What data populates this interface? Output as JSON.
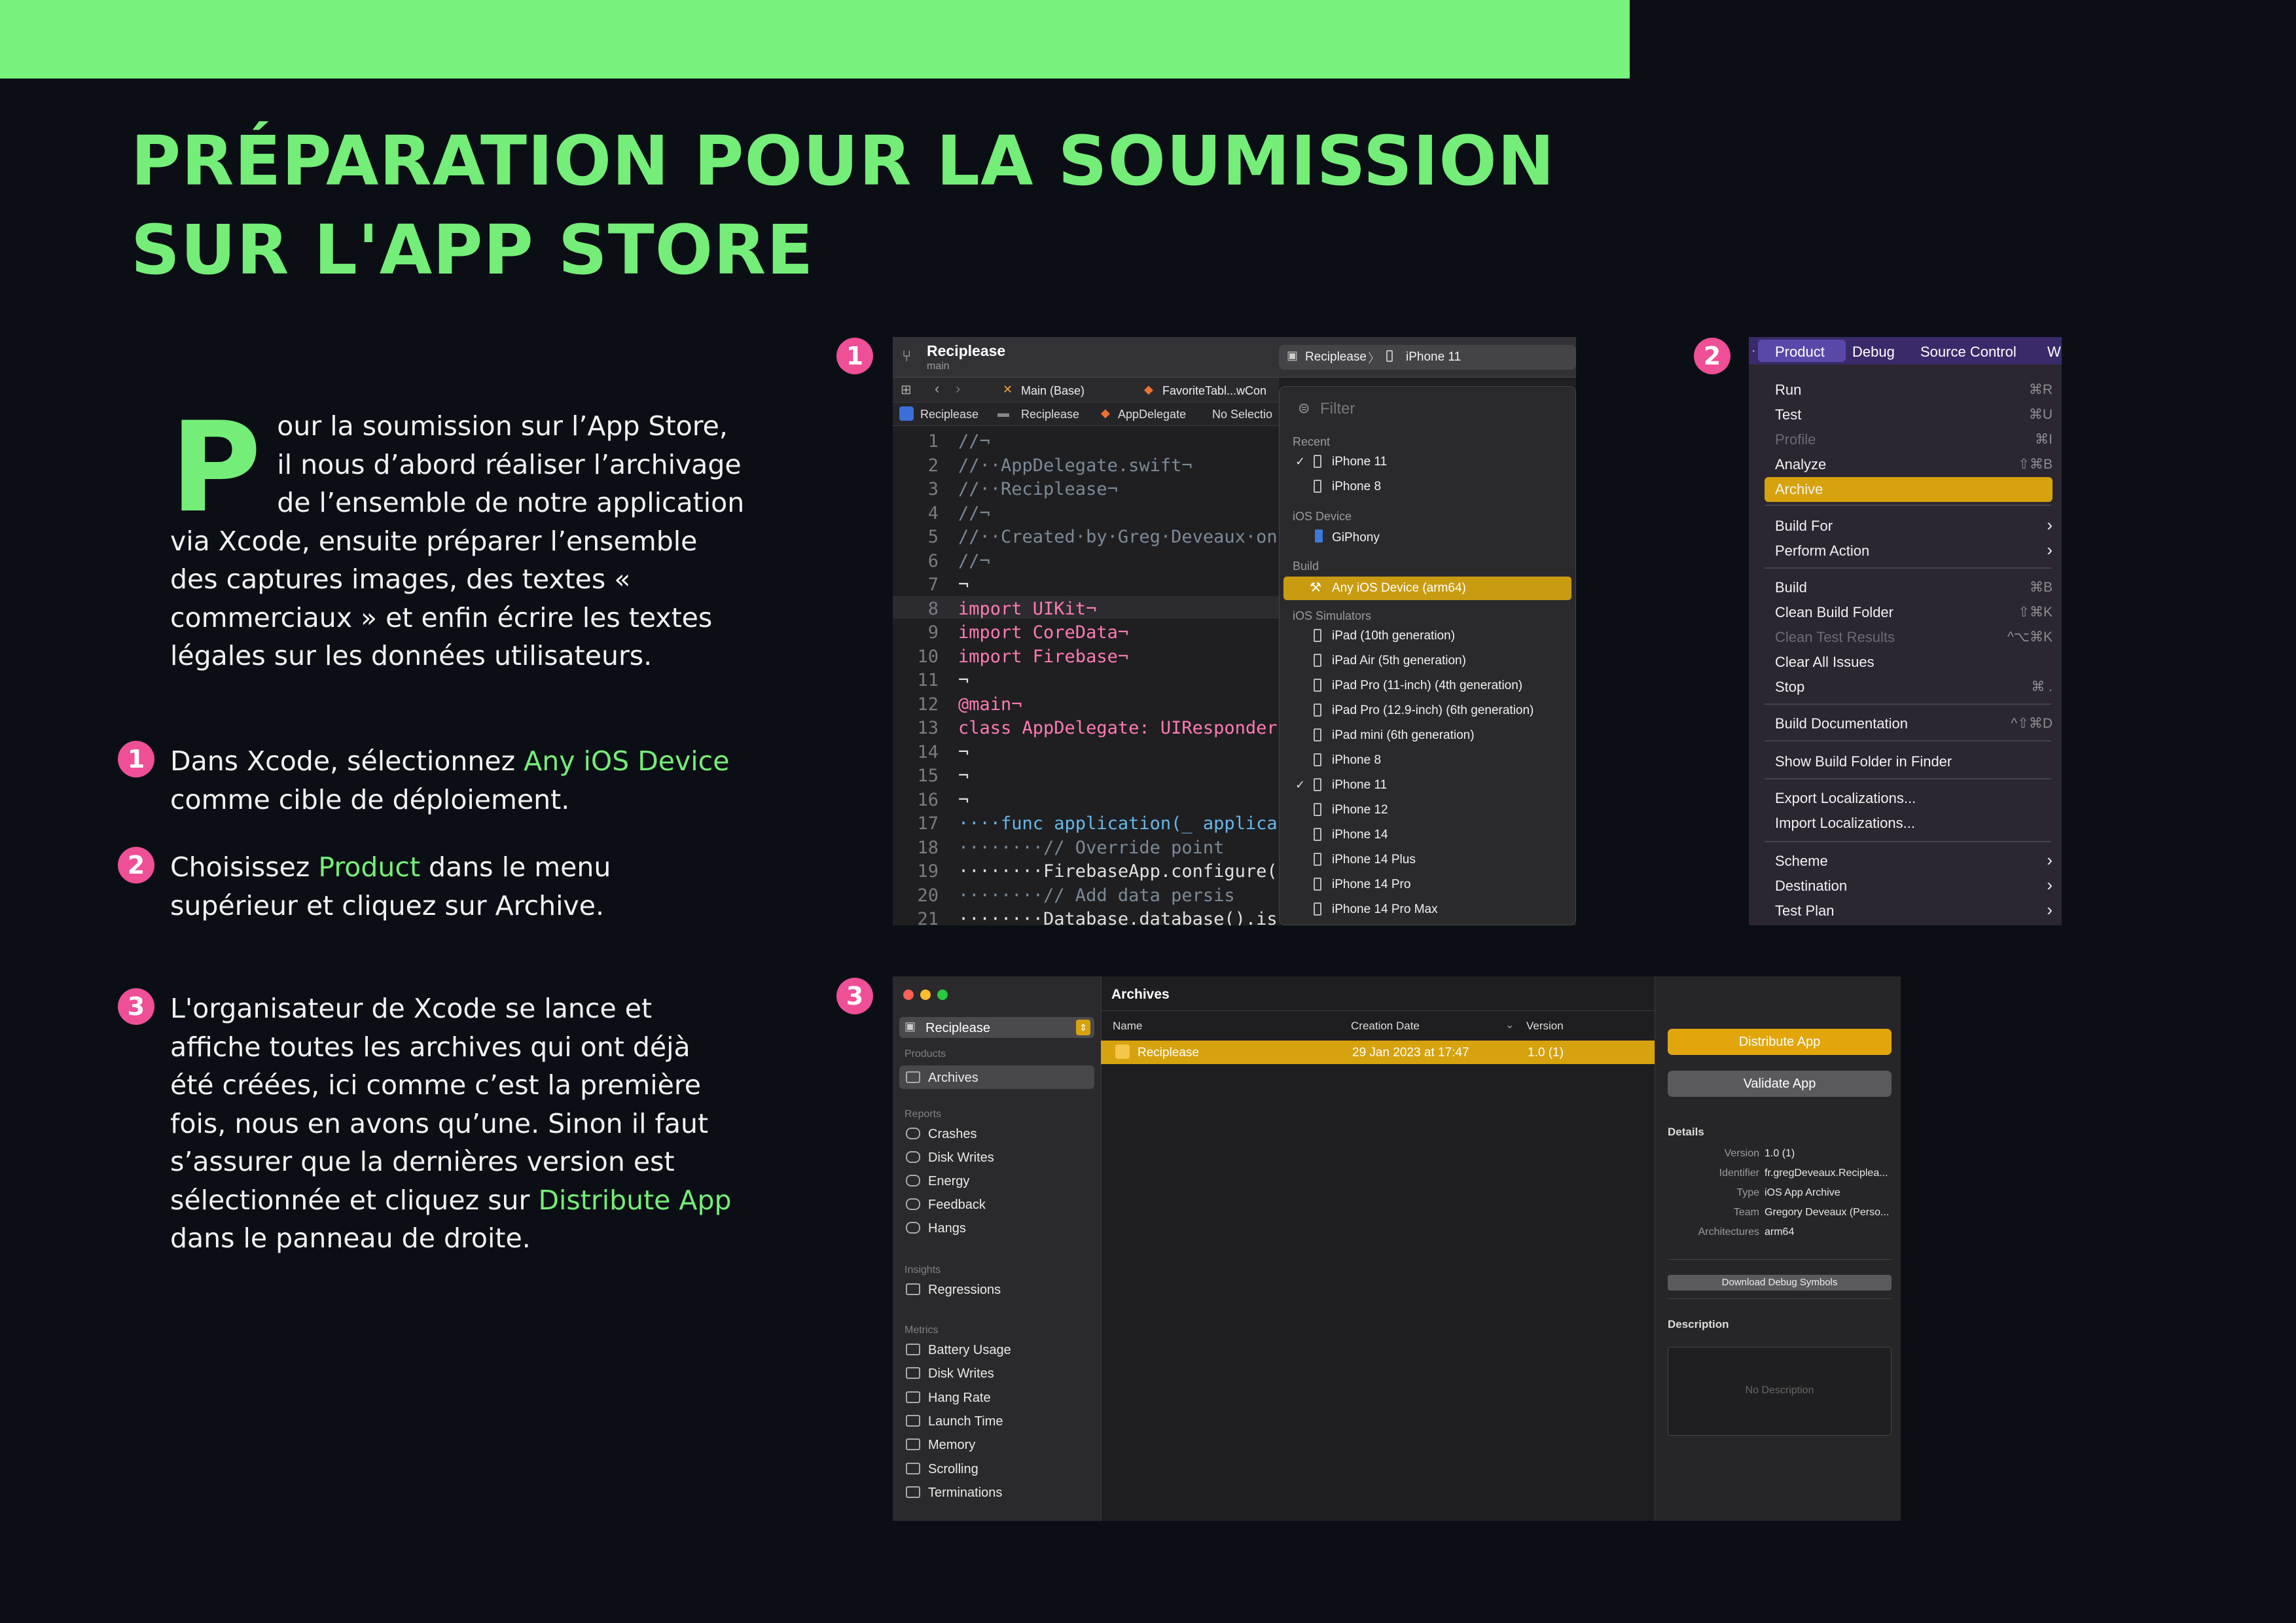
{
  "title": {
    "line1": "PRÉPARATION POUR LA SOUMISSION",
    "line2": "SUR L'APP STORE"
  },
  "intro": {
    "dropcap": "P",
    "text": "our la soumission sur l’App Store, il nous d’abord réaliser l’archivage de l’ensemble de notre application via Xcode, ensuite préparer l’ensemble des captures images, des textes « commerciaux » et enfin écrire les textes légales sur les données utilisateurs."
  },
  "steps": [
    {
      "num": "1",
      "before": "Dans Xcode, sélectionnez ",
      "highlight": "Any iOS Device",
      "after": " comme cible de déploiement."
    },
    {
      "num": "2",
      "before": "Choisissez ",
      "highlight": "Product",
      "after": " dans le menu supérieur et cliquez sur Archive."
    },
    {
      "num": "3",
      "before": "L'organisateur de Xcode se lance et affiche toutes les archives qui ont déjà été créées, ici comme c’est la première fois, nous en avons qu’une. Sinon il faut s’assurer que la dernières version est sélectionnée et cliquez sur ",
      "highlight": "Distribute App",
      "after": " dans le panneau de droite."
    }
  ],
  "shot_badges": [
    "1",
    "2",
    "3"
  ],
  "xcode": {
    "project": "Reciplease",
    "branch": "main",
    "scheme": "Reciplease",
    "device": "iPhone 11",
    "tabs": [
      "Main (Base)",
      "FavoriteTabl...wCon"
    ],
    "breadcrumb": [
      "Reciplease",
      "Reciplease",
      "AppDelegate",
      "No Selectio"
    ],
    "code_lines": [
      {
        "n": "1",
        "t": "//¬"
      },
      {
        "n": "2",
        "t": "//··AppDelegate.swift¬"
      },
      {
        "n": "3",
        "t": "//··Reciplease¬"
      },
      {
        "n": "4",
        "t": "//¬"
      },
      {
        "n": "5",
        "t": "//··Created·by·Greg·Deveaux·on"
      },
      {
        "n": "6",
        "t": "//¬"
      },
      {
        "n": "7",
        "t": "¬"
      },
      {
        "n": "8",
        "t": "import UIKit¬"
      },
      {
        "n": "9",
        "t": "import CoreData¬"
      },
      {
        "n": "10",
        "t": "import Firebase¬"
      },
      {
        "n": "11",
        "t": "¬"
      },
      {
        "n": "12",
        "t": "@main¬"
      },
      {
        "n": "13",
        "t": "class AppDelegate: UIResponder"
      },
      {
        "n": "14",
        "t": "¬"
      },
      {
        "n": "15",
        "t": "¬"
      },
      {
        "n": "16",
        "t": "¬"
      },
      {
        "n": "17",
        "t": "····func application(_ applica"
      },
      {
        "n": "18",
        "t": "········// Override point"
      },
      {
        "n": "19",
        "t": "········FirebaseApp.configure("
      },
      {
        "n": "20",
        "t": "········// Add data persis"
      },
      {
        "n": "21",
        "t": "········Database.database().is"
      }
    ],
    "filter_placeholder": "Filter",
    "sections": {
      "recent": "Recent",
      "ios_device": "iOS Device",
      "build": "Build",
      "simulators": "iOS Simulators"
    },
    "recent": [
      "iPhone 11",
      "iPhone 8"
    ],
    "ios_device": "GiPhony",
    "build_target": "Any iOS Device (arm64)",
    "simulators": [
      "iPad (10th generation)",
      "iPad Air (5th generation)",
      "iPad Pro (11-inch) (4th generation)",
      "iPad Pro (12.9-inch) (6th generation)",
      "iPad mini (6th generation)",
      "iPhone 8",
      "iPhone 11",
      "iPhone 12",
      "iPhone 14",
      "iPhone 14 Plus",
      "iPhone 14 Pro",
      "iPhone 14 Pro Max"
    ]
  },
  "product_menu": {
    "menubar": [
      "Product",
      "Debug",
      "Source Control",
      "W"
    ],
    "items": [
      {
        "label": "Run",
        "key": "⌘R"
      },
      {
        "label": "Test",
        "key": "⌘U"
      },
      {
        "label": "Profile",
        "key": "⌘I"
      },
      {
        "label": "Analyze",
        "key": "⇧⌘B"
      },
      {
        "label": "Archive",
        "key": ""
      },
      {
        "label": "Build For",
        "key": "›"
      },
      {
        "label": "Perform Action",
        "key": "›"
      },
      {
        "label": "Build",
        "key": "⌘B"
      },
      {
        "label": "Clean Build Folder",
        "key": "⇧⌘K"
      },
      {
        "label": "Clean Test Results",
        "key": "^⌥⌘K"
      },
      {
        "label": "Clear All Issues",
        "key": ""
      },
      {
        "label": "Stop",
        "key": "⌘ ."
      },
      {
        "label": "Build Documentation",
        "key": "^⇧⌘D"
      },
      {
        "label": "Show Build Folder in Finder",
        "key": ""
      },
      {
        "label": "Export Localizations...",
        "key": ""
      },
      {
        "label": "Import Localizations...",
        "key": ""
      },
      {
        "label": "Scheme",
        "key": "›"
      },
      {
        "label": "Destination",
        "key": "›"
      },
      {
        "label": "Test Plan",
        "key": "›"
      }
    ]
  },
  "organizer": {
    "scheme": "Reciplease",
    "sidebar": {
      "products_header": "Products",
      "archives": "Archives",
      "reports_header": "Reports",
      "reports": [
        "Crashes",
        "Disk Writes",
        "Energy",
        "Feedback",
        "Hangs"
      ],
      "insights_header": "Insights",
      "insights": [
        "Regressions"
      ],
      "metrics_header": "Metrics",
      "metrics": [
        "Battery Usage",
        "Disk Writes",
        "Hang Rate",
        "Launch Time",
        "Memory",
        "Scrolling",
        "Terminations"
      ]
    },
    "heading": "Archives",
    "columns": [
      "Name",
      "Creation Date",
      "Version"
    ],
    "rows": [
      {
        "name": "Reciplease",
        "date": "29 Jan 2023 at 17:47",
        "version": "1.0 (1)"
      }
    ],
    "buttons": {
      "distribute": "Distribute App",
      "validate": "Validate App",
      "debug_symbols": "Download Debug Symbols"
    },
    "details_header": "Details",
    "details": [
      {
        "k": "Version",
        "v": "1.0 (1)"
      },
      {
        "k": "Identifier",
        "v": "fr.gregDeveaux.Recipleа..."
      },
      {
        "k": "Type",
        "v": "iOS App Archive"
      },
      {
        "k": "Team",
        "v": "Gregory Deveaux (Perso..."
      },
      {
        "k": "Architectures",
        "v": "arm64"
      }
    ],
    "description_header": "Description",
    "description_placeholder": "No Description"
  },
  "colors": {
    "accent": "#74ee78",
    "badge": "#ee4f97",
    "selection": "#d6a20e",
    "background": "#0b0f15"
  }
}
